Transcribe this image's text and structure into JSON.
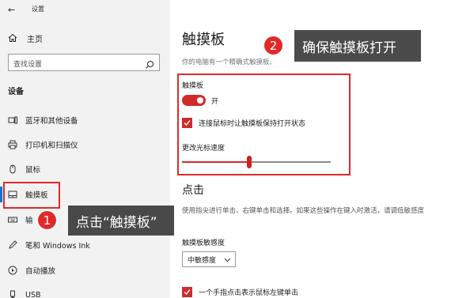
{
  "window": {
    "back_glyph": "←",
    "title": "设置"
  },
  "sidebar": {
    "home_label": "主页",
    "search_placeholder": "查找设置",
    "section": "设备",
    "items": [
      {
        "label": "蓝牙和其他设备",
        "icon": "bluetooth-icon"
      },
      {
        "label": "打印机和扫描仪",
        "icon": "printer-icon"
      },
      {
        "label": "鼠标",
        "icon": "mouse-icon"
      },
      {
        "label": "触摸板",
        "icon": "touchpad-icon",
        "active": true
      },
      {
        "label": "输",
        "icon": "keyboard-icon"
      },
      {
        "label": "笔和 Windows Ink",
        "icon": "pen-icon"
      },
      {
        "label": "自动播放",
        "icon": "autoplay-icon"
      },
      {
        "label": "USB",
        "icon": "usb-icon"
      }
    ]
  },
  "main": {
    "title": "触摸板",
    "subtitle": "你的电脑有一个精确式触摸板。",
    "touchpad_label": "触摸板",
    "toggle_state": "开",
    "toggle_on": true,
    "keep_on_label": "连接鼠标时让触摸板保持打开状态",
    "keep_on_checked": true,
    "speed_label": "更改光标速度",
    "speed_level": 0.45,
    "click_title": "点击",
    "click_desc": "使用指尖进行单击、右键单击和选择。如果这些操作在键入时激活，请调低敏感度",
    "sensitivity_label": "触摸板敏感度",
    "sensitivity_value": "中敏感度",
    "single_tap_label": "一个手指点击表示鼠标左键单击",
    "single_tap_checked": true
  },
  "callouts": [
    {
      "number": "1",
      "text": "点击“触摸板”"
    },
    {
      "number": "2",
      "text": "确保触摸板打开"
    }
  ],
  "colors": {
    "accent_red": "#d12a2a",
    "highlight_red": "#e02a2a",
    "sidebar_bg": "#f2f2f2",
    "callout_bg": "#2d2d2d"
  }
}
